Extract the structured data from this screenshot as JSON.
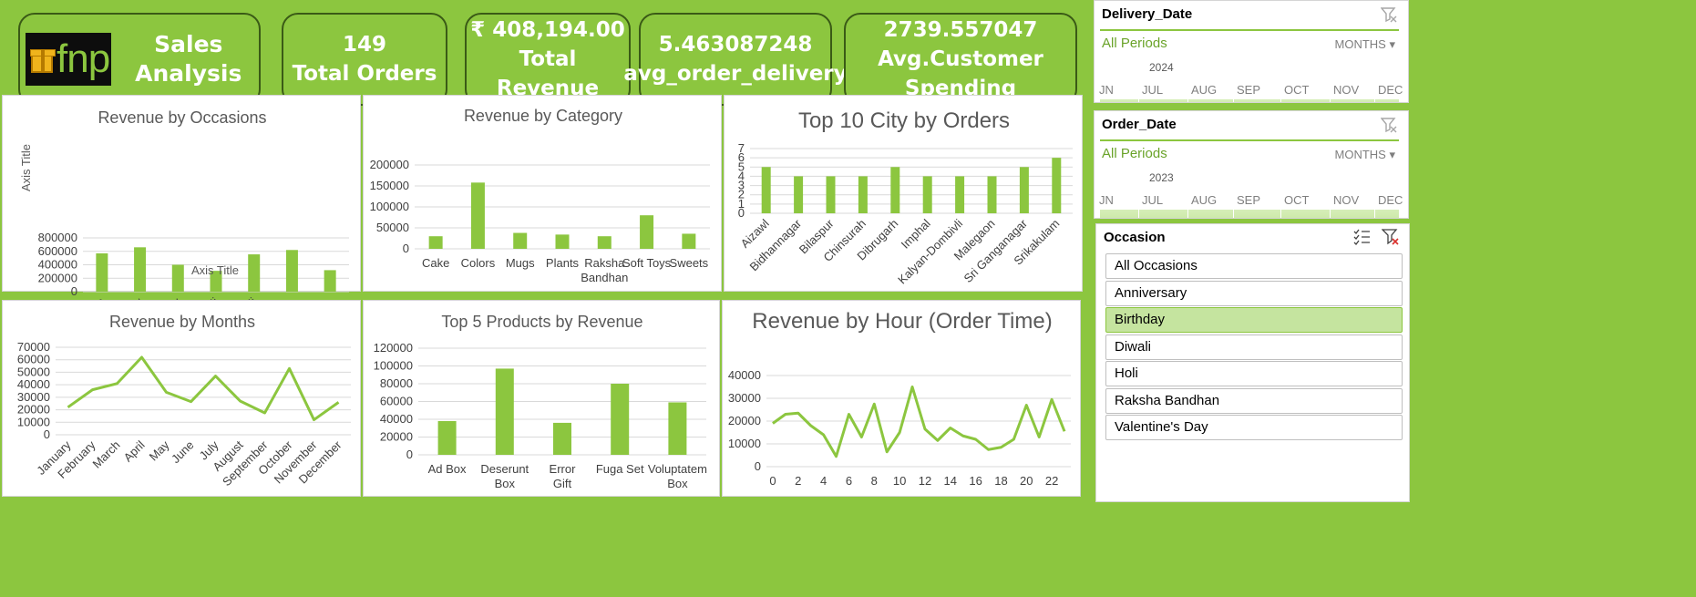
{
  "kpis": {
    "brand": "fnp",
    "title": "Sales Analysis",
    "orders_value": "149",
    "orders_label": "Total Orders",
    "revenue_value": "₹ 408,194.00",
    "revenue_label": "Total Revenue",
    "delivery_value": "5.463087248",
    "delivery_label": "avg_order_delivery",
    "spend_value": "2739.557047",
    "spend_label": "Avg.Customer Spending"
  },
  "slicers": {
    "delivery": {
      "title": "Delivery_Date",
      "all": "All Periods",
      "level": "MONTHS",
      "year": "2024",
      "months": [
        "JN",
        "JUL",
        "AUG",
        "SEP",
        "OCT",
        "NOV",
        "DEC"
      ]
    },
    "order": {
      "title": "Order_Date",
      "all": "All Periods",
      "level": "MONTHS",
      "year": "2023",
      "months": [
        "JN",
        "JUL",
        "AUG",
        "SEP",
        "OCT",
        "NOV",
        "DEC"
      ]
    },
    "occasion": {
      "title": "Occasion",
      "selected": "Birthday",
      "items": [
        "All Occasions",
        "Anniversary",
        "Birthday",
        "Diwali",
        "Holi",
        "Raksha Bandhan",
        "Valentine's Day"
      ]
    }
  },
  "colors": {
    "accent": "#8cc63f",
    "bar": "#8cc63f",
    "line": "#8cc63f"
  },
  "chart_data": [
    {
      "id": "occasions",
      "type": "bar",
      "title": "Revenue by Occasions",
      "categories": [
        "All Occasions",
        "Anniversary",
        "Birthday",
        "Diwali",
        "Holi",
        "Raksha...",
        "Valentine's..."
      ],
      "values": [
        570000,
        660000,
        400000,
        310000,
        555000,
        620000,
        320000
      ],
      "xlabel": "Axis Title",
      "ylabel": "Axis Title",
      "ylim": [
        0,
        800000
      ],
      "yticks": [
        "0",
        "200000",
        "400000",
        "600000",
        "800000"
      ],
      "grid": true
    },
    {
      "id": "category",
      "type": "bar",
      "title": "Revenue by Category",
      "categories": [
        "Cake",
        "Colors",
        "Mugs",
        "Plants",
        "Raksha Bandhan",
        "Soft Toys",
        "Sweets"
      ],
      "values": [
        30000,
        158000,
        38000,
        34000,
        30000,
        80000,
        36000
      ],
      "ylim": [
        0,
        200000
      ],
      "yticks": [
        "0",
        "50000",
        "100000",
        "150000",
        "200000"
      ],
      "grid": true
    },
    {
      "id": "cities",
      "type": "bar",
      "title": "Top 10 City by Orders",
      "categories": [
        "Aizawl",
        "Bidhannagar",
        "Bilaspur",
        "Chinsurah",
        "Dibrugarh",
        "Imphal",
        "Kalyan-Dombivli",
        "Malegaon",
        "Sri Ganganagar",
        "Srikakulam"
      ],
      "values": [
        5,
        4,
        4,
        4,
        5,
        4,
        4,
        4,
        5,
        6
      ],
      "ylim": [
        0,
        7
      ],
      "yticks": [
        "0",
        "1",
        "2",
        "3",
        "4",
        "5",
        "6",
        "7"
      ],
      "grid": true
    },
    {
      "id": "months",
      "type": "line",
      "title": "Revenue by Months",
      "categories": [
        "January",
        "February",
        "March",
        "April",
        "May",
        "June",
        "July",
        "August",
        "September",
        "October",
        "November",
        "December"
      ],
      "values": [
        22000,
        36000,
        41000,
        62000,
        34000,
        26500,
        47000,
        27000,
        17500,
        53000,
        12000,
        26000
      ],
      "ylim": [
        0,
        70000
      ],
      "yticks": [
        "0",
        "10000",
        "20000",
        "30000",
        "40000",
        "50000",
        "60000",
        "70000"
      ],
      "grid": true
    },
    {
      "id": "products",
      "type": "bar",
      "title": "Top 5 Products by Revenue",
      "categories": [
        "Ad Box",
        "Deserunt Box",
        "Error Gift",
        "Fuga Set",
        "Voluptatem Box"
      ],
      "values": [
        38000,
        97000,
        36000,
        80000,
        59000
      ],
      "ylim": [
        0,
        120000
      ],
      "yticks": [
        "0",
        "20000",
        "40000",
        "60000",
        "80000",
        "100000",
        "120000"
      ],
      "grid": true
    },
    {
      "id": "hours",
      "type": "line",
      "title": "Revenue by Hour (Order Time)",
      "x": [
        0,
        1,
        2,
        3,
        4,
        5,
        6,
        7,
        8,
        9,
        10,
        11,
        12,
        13,
        14,
        15,
        16,
        17,
        18,
        19,
        20,
        21,
        22,
        23
      ],
      "values": [
        19000,
        23000,
        23500,
        18000,
        14000,
        4500,
        23000,
        13000,
        27500,
        6500,
        15000,
        35000,
        16500,
        11500,
        17000,
        13500,
        12000,
        7500,
        8500,
        12000,
        27000,
        13000,
        29500,
        15500
      ],
      "xticks": [
        "0",
        "2",
        "4",
        "6",
        "8",
        "10",
        "12",
        "14",
        "16",
        "18",
        "20",
        "22"
      ],
      "ylim": [
        0,
        40000
      ],
      "yticks": [
        "0",
        "10000",
        "20000",
        "30000",
        "40000"
      ],
      "grid": true
    }
  ]
}
